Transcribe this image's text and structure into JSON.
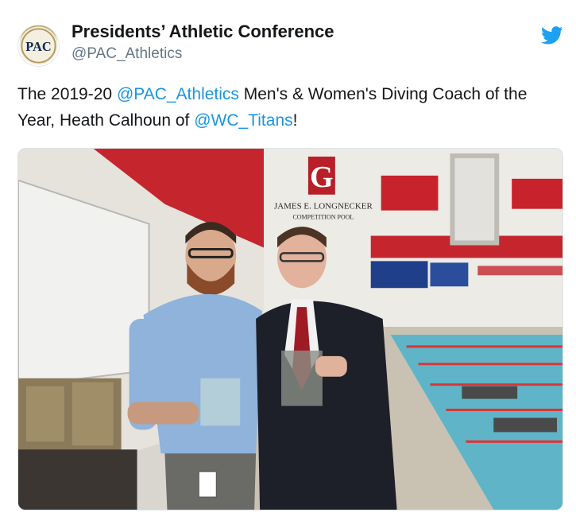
{
  "tweet": {
    "display_name": "Presidents’ Athletic Conference",
    "handle": "@PAC_Athletics",
    "avatar_text": "PAC",
    "text_parts": {
      "p1": "The 2019-20 ",
      "mention1": "@PAC_Athletics",
      "p2": " Men's & Women's Diving Coach of the Year, Heath Calhoun of ",
      "mention2": "@WC_Titans",
      "p3": "!"
    }
  },
  "photo": {
    "wall_banner_line1": "JAMES E. LONGNECKER",
    "wall_banner_line2": "COMPETITION POOL",
    "wall_letter": "G",
    "icons": {
      "logo": "pac-logo-icon",
      "platform": "twitter-bird-icon"
    }
  },
  "colors": {
    "link": "#1b95e0",
    "handle": "#657786",
    "text": "#14171a",
    "twitter_blue": "#1da1f2"
  }
}
